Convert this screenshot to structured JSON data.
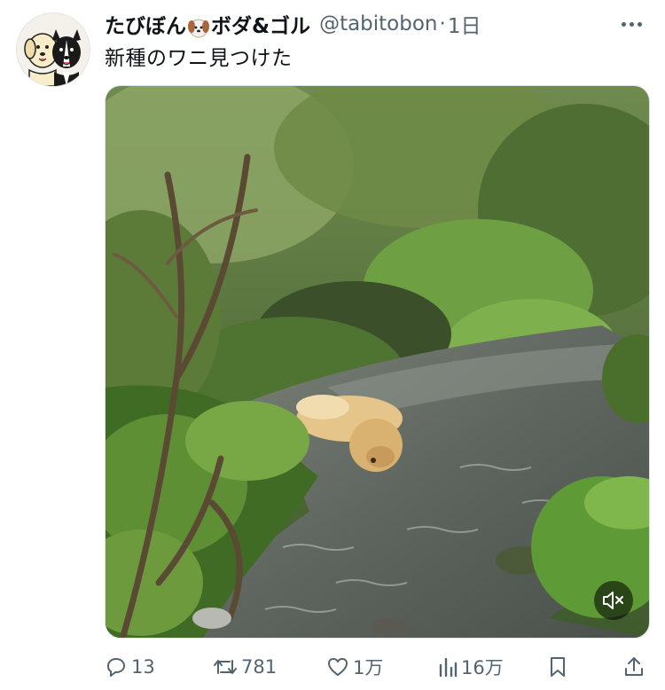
{
  "user": {
    "display_name_part1": "たびぼん",
    "display_name_part2": "ボダ&ゴル",
    "handle": "@tabitobon",
    "separator": "·",
    "time": "1日"
  },
  "tweet": {
    "text": "新種のワニ見つけた"
  },
  "icons": {
    "more": "more-dots-icon",
    "mute": "speaker-muted-icon",
    "reply": "reply-bubble-icon",
    "retweet": "retweet-icon",
    "like": "heart-icon",
    "views": "views-bars-icon",
    "bookmark": "bookmark-icon",
    "share": "share-upload-icon",
    "emoji": "dog-face-emoji"
  },
  "actions": {
    "replies": "13",
    "retweets": "781",
    "likes": "1万",
    "views": "16万"
  },
  "colors": {
    "text": "#0f1419",
    "secondary": "#536471"
  }
}
